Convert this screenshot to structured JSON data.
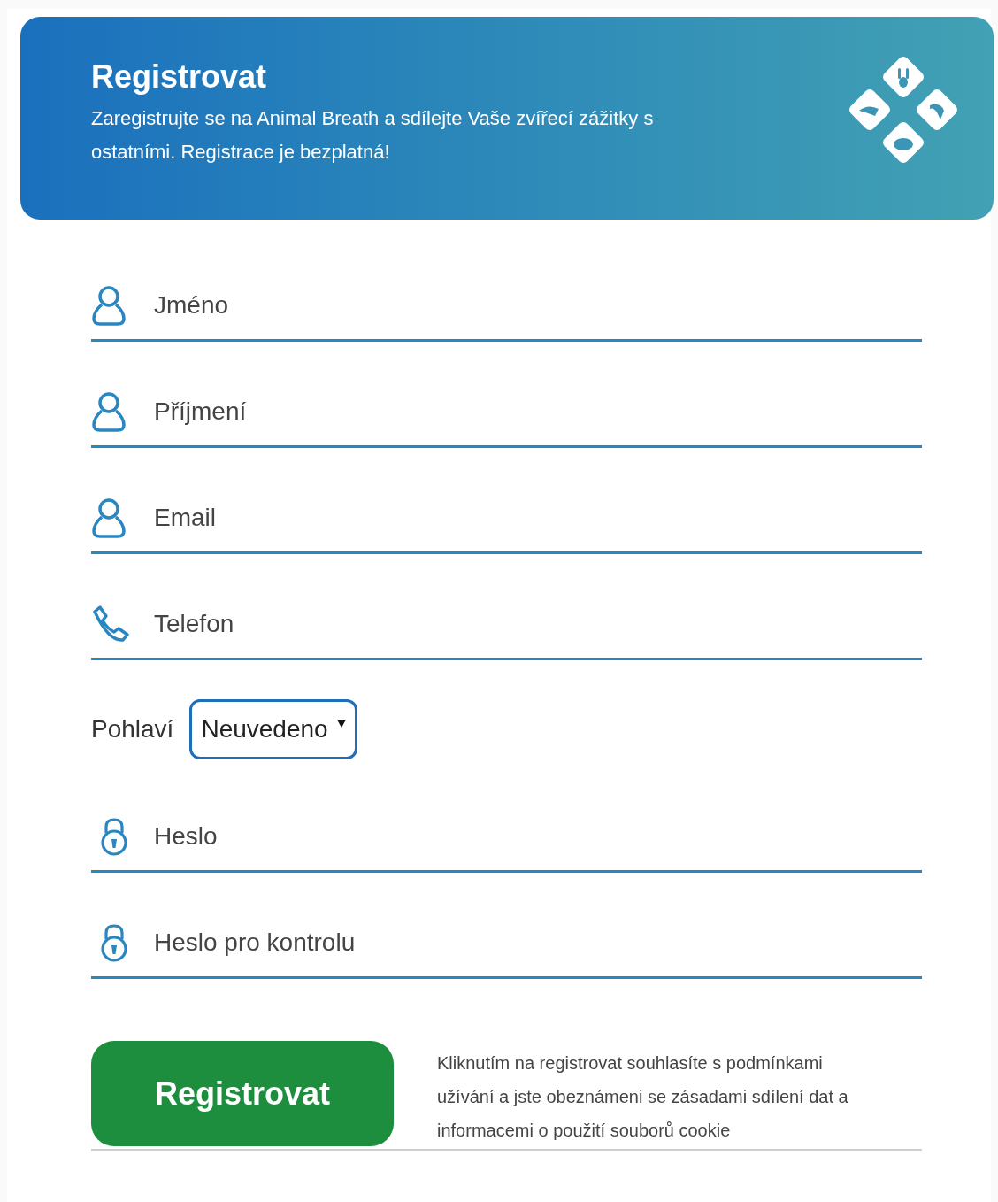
{
  "header": {
    "title": "Registrovat",
    "subtitle": "Zaregistrujte se na Animal Breath a sdílejte Vaše zvířecí zážitky s ostatními. Registrace je bezplatná!"
  },
  "fields": [
    {
      "kind": "person",
      "placeholder": "Jméno"
    },
    {
      "kind": "person",
      "placeholder": "Příjmení"
    },
    {
      "kind": "person",
      "placeholder": "Email"
    },
    {
      "kind": "phone",
      "placeholder": "Telefon"
    },
    {
      "kind": "select",
      "label": "Pohlaví",
      "value": "Neuvedeno"
    },
    {
      "kind": "lock",
      "placeholder": "Heslo"
    },
    {
      "kind": "lock",
      "placeholder": "Heslo pro kontrolu"
    }
  ],
  "submit": {
    "label": "Registrovat"
  },
  "consent": "Kliknutím na registrovat souhlasíte s podmínkami užívání a jste obeznámeni se zásadami sdílení dat a informacemi o použití souborů cookie"
}
